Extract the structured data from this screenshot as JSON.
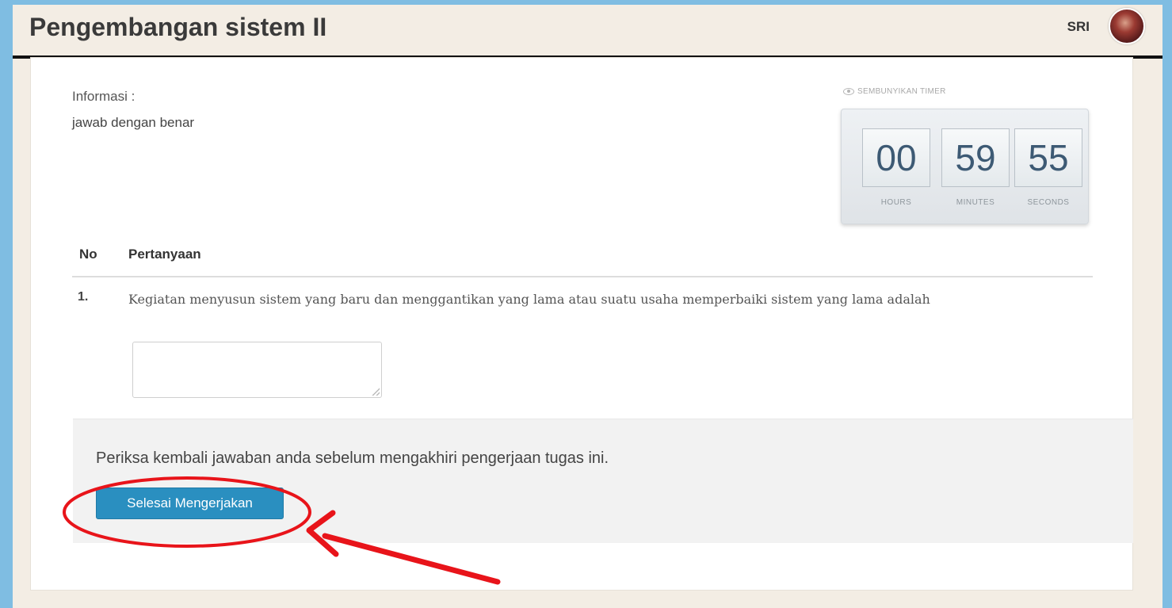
{
  "header": {
    "title": "Pengembangan sistem II",
    "user_name": "SRI"
  },
  "info": {
    "label": "Informasi :",
    "text": "jawab dengan benar"
  },
  "timer": {
    "hide_label": "SEMBUNYIKAN TIMER",
    "hours": "00",
    "minutes": "59",
    "seconds": "55",
    "hours_label": "HOURS",
    "minutes_label": "MINUTES",
    "seconds_label": "SECONDS"
  },
  "table": {
    "headers": [
      "No",
      "Pertanyaan"
    ],
    "rows": [
      {
        "number": "1.",
        "question": "Kegiatan menyusun sistem yang baru dan menggantikan yang lama atau suatu usaha memperbaiki sistem yang lama adalah",
        "answer": ""
      }
    ]
  },
  "footer": {
    "reminder": "Periksa kembali jawaban anda sebelum mengakhiri pengerjaan tugas ini.",
    "finish_label": "Selesai Mengerjakan"
  },
  "colors": {
    "background": "#7fbde2",
    "accent_button": "#2a8fc0",
    "annotation": "#e8141a"
  },
  "icons": {
    "hide_timer": "eye-icon"
  }
}
